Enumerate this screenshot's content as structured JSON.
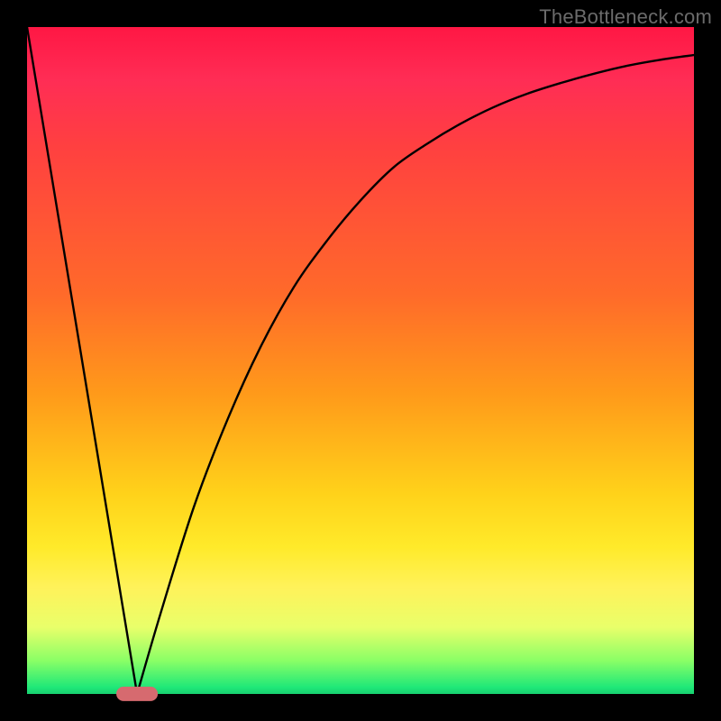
{
  "watermark": "TheBottleneck.com",
  "chart_data": {
    "type": "line",
    "title": "",
    "xlabel": "",
    "ylabel": "",
    "xlim": [
      0,
      100
    ],
    "ylim": [
      0,
      100
    ],
    "grid": false,
    "legend": false,
    "background_gradient": {
      "direction": "vertical",
      "stops": [
        {
          "pos": 0.0,
          "color": "#ff1744"
        },
        {
          "pos": 0.4,
          "color": "#ff6a2a"
        },
        {
          "pos": 0.7,
          "color": "#ffd21a"
        },
        {
          "pos": 0.9,
          "color": "#e9ff6a"
        },
        {
          "pos": 1.0,
          "color": "#18d070"
        }
      ]
    },
    "series": [
      {
        "name": "left-branch",
        "x": [
          0,
          16.5
        ],
        "y": [
          100,
          0
        ],
        "style": "linear"
      },
      {
        "name": "right-branch",
        "x": [
          16.5,
          20,
          25,
          30,
          35,
          40,
          45,
          50,
          55,
          60,
          65,
          70,
          75,
          80,
          85,
          90,
          95,
          100
        ],
        "y": [
          0,
          12,
          28,
          41,
          52,
          61,
          68,
          74,
          79,
          82.5,
          85.5,
          88,
          90,
          91.6,
          93,
          94.2,
          95.1,
          95.8
        ],
        "style": "smooth"
      }
    ],
    "marker": {
      "x": 16.5,
      "y": 0,
      "shape": "rounded-rect",
      "color": "#d66a6f",
      "width_pct": 6.2,
      "height_pct": 2.2
    }
  }
}
